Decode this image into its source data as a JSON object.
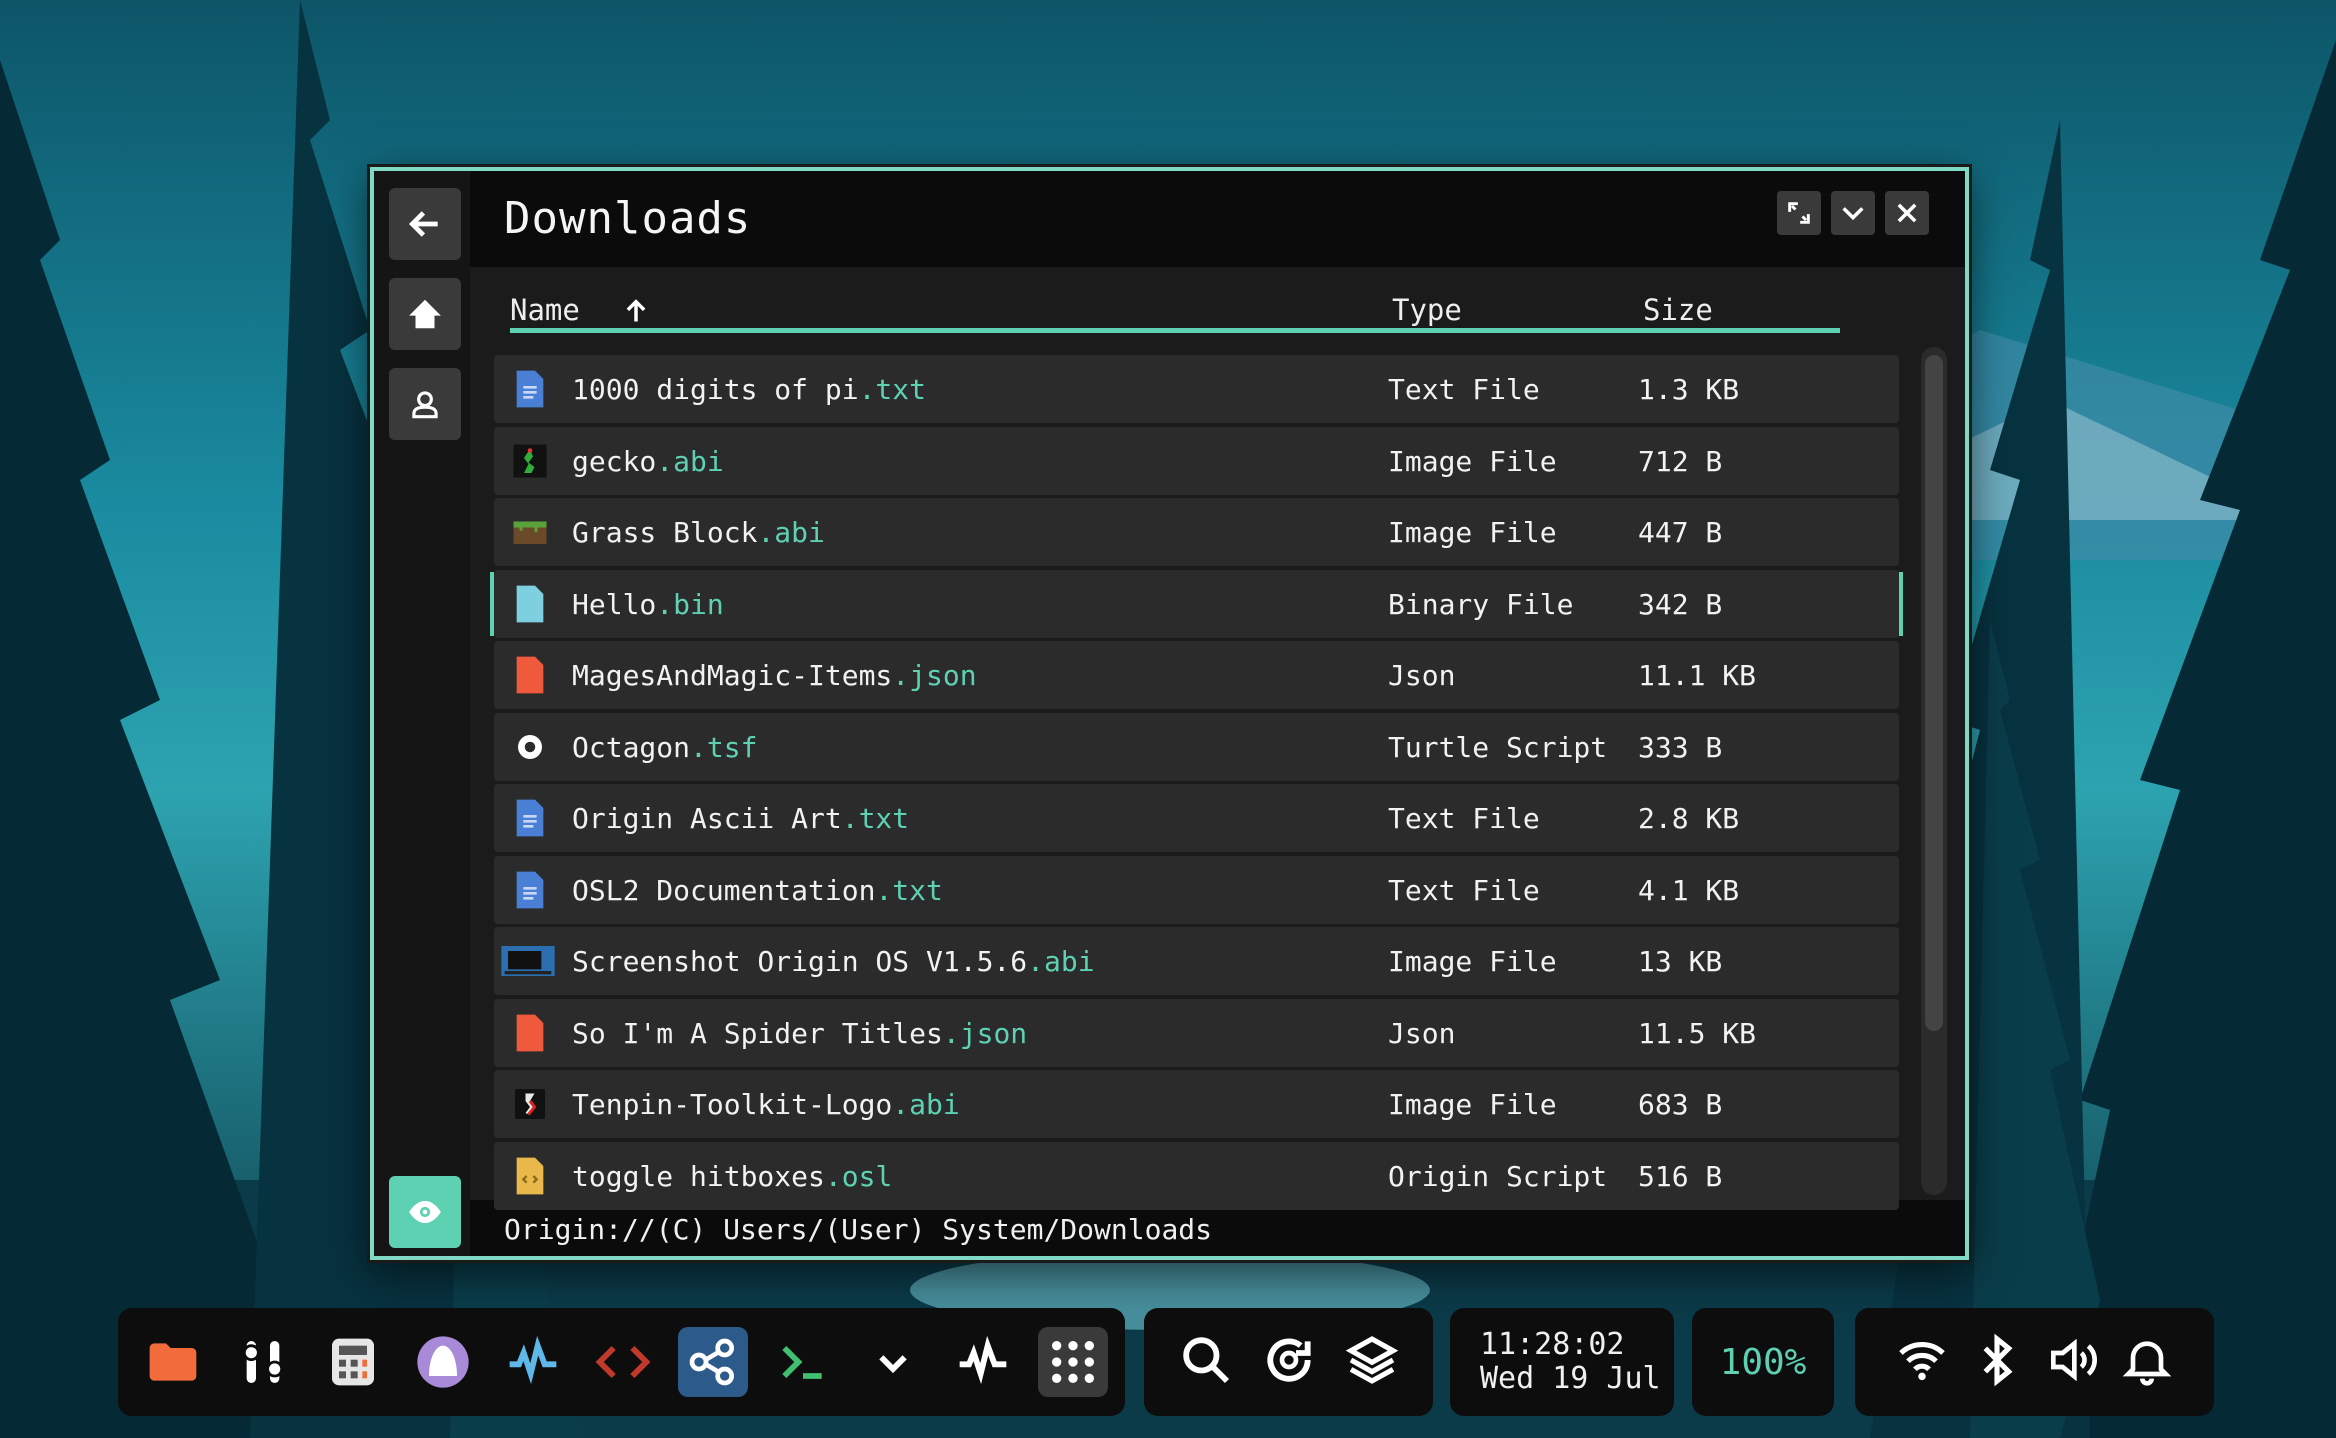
{
  "window": {
    "title": "Downloads",
    "path": "Origin://(C) Users/(User) System/Downloads"
  },
  "columns": {
    "name": "Name",
    "type": "Type",
    "size": "Size",
    "sort": "ascending"
  },
  "files": [
    {
      "base": "1000 digits of pi",
      "ext": ".txt",
      "type": "Text File",
      "size": "1.3 KB",
      "icon": "text-file-icon"
    },
    {
      "base": "gecko",
      "ext": ".abi",
      "type": "Image File",
      "size": "712 B",
      "icon": "gecko-image-icon"
    },
    {
      "base": "Grass Block",
      "ext": ".abi",
      "type": "Image File",
      "size": "447 B",
      "icon": "grass-block-image-icon"
    },
    {
      "base": "Hello",
      "ext": ".bin",
      "type": "Binary File",
      "size": "342 B",
      "icon": "binary-file-icon",
      "selected": true
    },
    {
      "base": "MagesAndMagic-Items",
      "ext": ".json",
      "type": "Json",
      "size": "11.1 KB",
      "icon": "json-file-icon"
    },
    {
      "base": "Octagon",
      "ext": ".tsf",
      "type": "Turtle Script",
      "size": "333 B",
      "icon": "turtle-script-icon"
    },
    {
      "base": "Origin Ascii Art",
      "ext": ".txt",
      "type": "Text File",
      "size": "2.8 KB",
      "icon": "text-file-icon"
    },
    {
      "base": "OSL2 Documentation",
      "ext": ".txt",
      "type": "Text File",
      "size": "4.1 KB",
      "icon": "text-file-icon"
    },
    {
      "base": "Screenshot Origin OS V1.5.6",
      "ext": ".abi",
      "type": "Image File",
      "size": "13 KB",
      "icon": "screenshot-image-icon"
    },
    {
      "base": "So I'm A Spider Titles",
      "ext": ".json",
      "type": "Json",
      "size": "11.5 KB",
      "icon": "json-file-icon"
    },
    {
      "base": "Tenpin-Toolkit-Logo",
      "ext": ".abi",
      "type": "Image File",
      "size": "683 B",
      "icon": "tenpin-logo-image-icon"
    },
    {
      "base": "toggle hitboxes",
      "ext": ".osl",
      "type": "Origin Script",
      "size": "516 B",
      "icon": "origin-script-icon"
    }
  ],
  "colors": {
    "accent": "#5dd1b2",
    "window_border": "#7fd9c5",
    "text_file": "#4a7fd6",
    "json_file": "#f05a3c",
    "binary_file": "#7ecfe0",
    "origin_script": "#e8b84a"
  },
  "sidebar": [
    "back-arrow-icon",
    "home-icon",
    "user-icon",
    "eye-icon"
  ],
  "window_controls": [
    "maximize-icon",
    "minimize-icon",
    "close-icon"
  ],
  "dock": {
    "apps": [
      "files-icon",
      "settings-icon",
      "calculator-icon",
      "origin-logo-icon",
      "activity-icon",
      "code-icon",
      "share-icon",
      "terminal-icon",
      "chevron-down-icon",
      "pulse-icon",
      "app-grid-icon"
    ],
    "tools": [
      "search-icon",
      "refresh-icon",
      "layers-icon"
    ],
    "clock_time": "11:28:02",
    "clock_date": "Wed 19 Jul",
    "battery": "100%",
    "status": [
      "wifi-icon",
      "bluetooth-icon",
      "volume-icon",
      "bell-icon"
    ]
  }
}
